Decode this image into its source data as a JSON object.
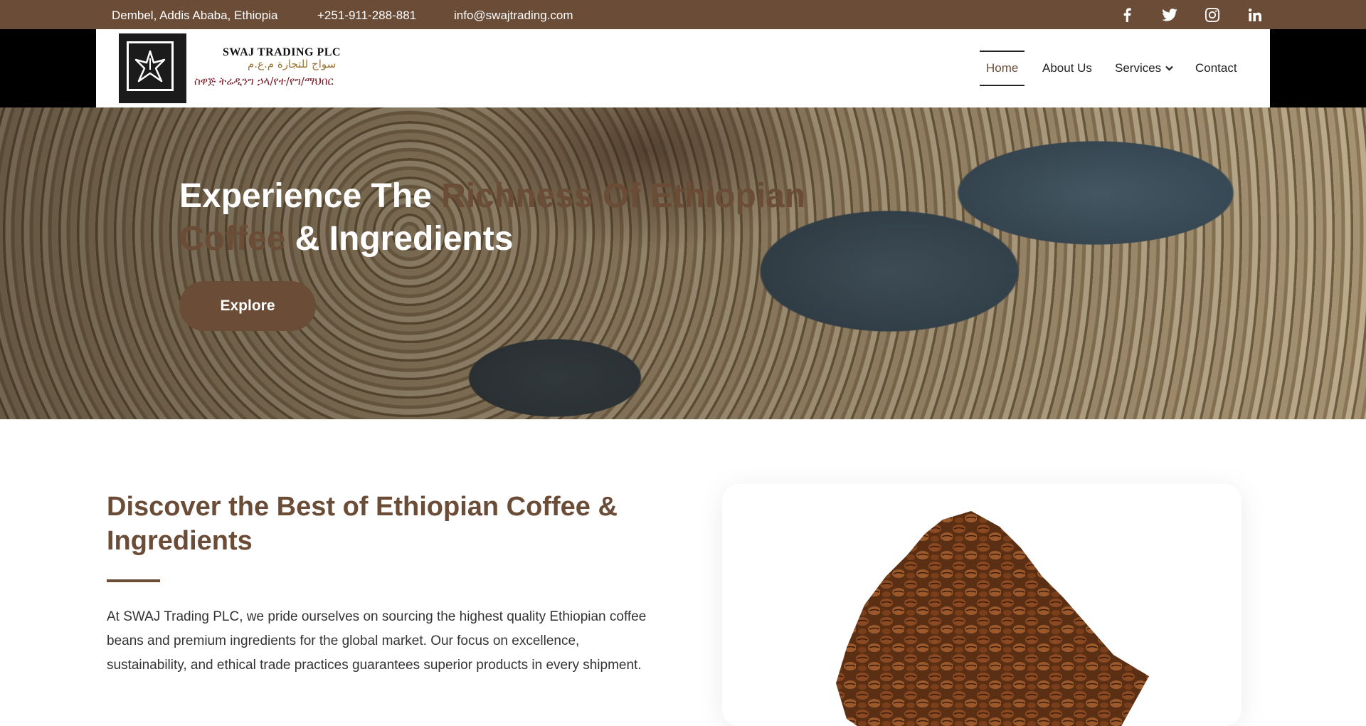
{
  "topbar": {
    "address": "Dembel, Addis Ababa, Ethiopia",
    "phone": "+251-911-288-881",
    "email": "info@swajtrading.com",
    "social": [
      "facebook-icon",
      "twitter-icon",
      "instagram-icon",
      "linkedin-icon"
    ],
    "background": "#6b4c37"
  },
  "logo": {
    "name_en": "SWAJ TRADING PLC",
    "name_ar": "سواج للتجارة م.ع.م",
    "name_am": "ስዋጅ ትሬዲንግ ኃላ/የተ/የግ/ማህበር"
  },
  "nav": {
    "items": [
      {
        "label": "Home",
        "active": true
      },
      {
        "label": "About Us",
        "active": false
      },
      {
        "label": "Services",
        "active": false
      },
      {
        "label": "Contact",
        "active": false
      }
    ]
  },
  "hero": {
    "title_part1": "Experience The ",
    "title_accent": "Richness Of Ethiopian Coffee",
    "title_part2": " & Ingredients",
    "button": "Explore"
  },
  "intro": {
    "title": "Discover the Best of Ethiopian Coffee & Ingredients",
    "text": "At SWAJ Trading PLC, we pride ourselves on sourcing the highest quality Ethiopian coffee beans and premium ingredients for the global market. Our focus on excellence, sustainability, and ethical trade practices guarantees superior products in every shipment."
  },
  "colors": {
    "brand_brown": "#6b4c37",
    "nav_active": "#6b4c37"
  }
}
